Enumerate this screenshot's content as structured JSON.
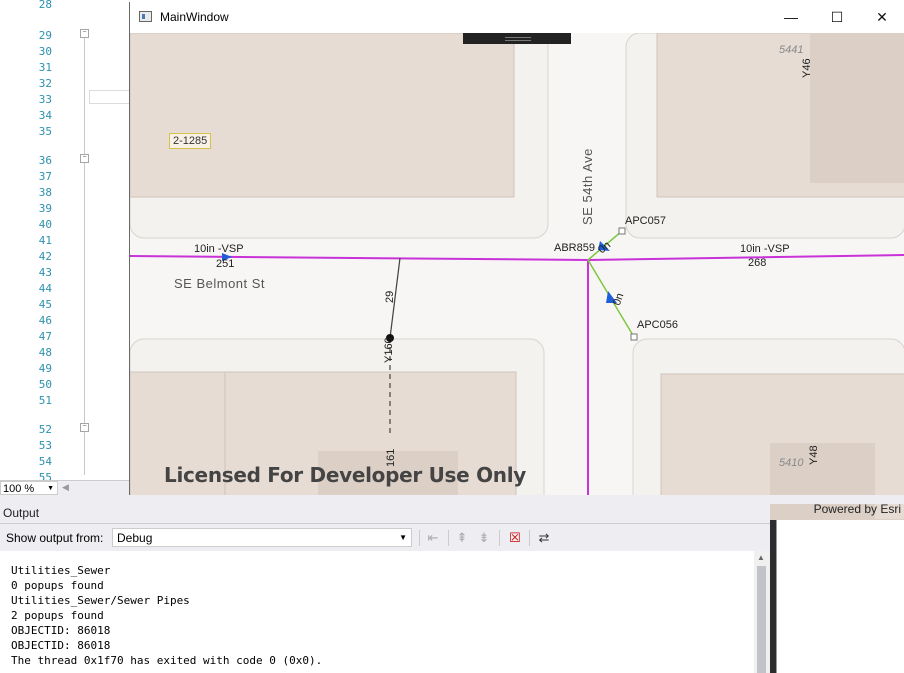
{
  "editor": {
    "line_numbers": [
      "28",
      "29",
      "30",
      "31",
      "32",
      "33",
      "34",
      "35",
      "36",
      "37",
      "38",
      "39",
      "40",
      "41",
      "42",
      "43",
      "44",
      "45",
      "46",
      "47",
      "48",
      "49",
      "50",
      "51",
      "52",
      "53",
      "54",
      "55"
    ],
    "zoom": "100 %"
  },
  "window": {
    "title": "MainWindow",
    "minimize": "—",
    "maximize": "☐",
    "close": "✕"
  },
  "map": {
    "streets": {
      "horizontal": "SE Belmont St",
      "vertical": "SE 54th Ave"
    },
    "parcel_label": "2-1285",
    "features": {
      "pipe_left_size": "10in -VSP",
      "pipe_left_id": "251",
      "pipe_right_size": "10in -VSP",
      "pipe_right_id": "268",
      "node_main": "ABR859",
      "node_upper": "APC057",
      "node_lower": "APC056",
      "lateral_upper": "0n",
      "lateral_lower": "0n",
      "lateral_29": "29",
      "lateral_y160": "Y160",
      "lateral_161": "161"
    },
    "house_numbers": {
      "upper_right": "5441",
      "upper_right_y": "Y46",
      "lower_right": "5410",
      "lower_right_y": "Y48"
    },
    "license_text": "Licensed For Developer Use Only",
    "attribution": "Powered by Esri",
    "colors": {
      "sewer_main": "#c832d8",
      "lateral": "#7ec840",
      "building": "#e6dcd4",
      "road": "#ffffff"
    }
  },
  "output": {
    "title": "Output",
    "show_from_label": "Show output from:",
    "source": "Debug",
    "lines": [
      "Utilities_Sewer",
      "0 popups found",
      "Utilities_Sewer/Sewer Pipes",
      "2 popups found",
      "OBJECTID: 86018",
      "OBJECTID: 86018",
      "The thread 0x1f70 has exited with code 0 (0x0)."
    ]
  }
}
